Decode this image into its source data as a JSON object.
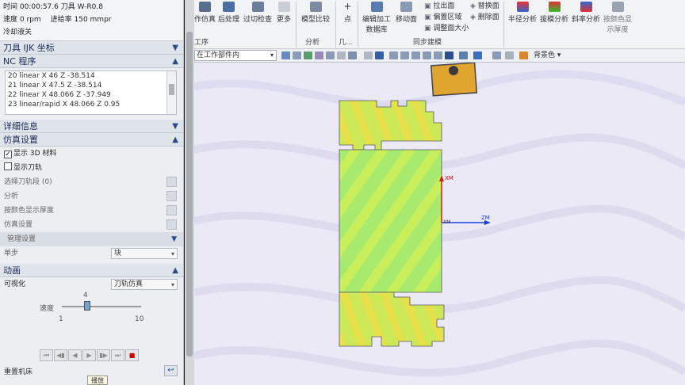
{
  "status": {
    "line1": "时间 00:00:57.6 刀具 W-R0.8",
    "speed": "速度 0 rpm",
    "feed": "进给率 150 mmpr",
    "coolant": "冷却液关"
  },
  "sections": {
    "tool_ijk": "刀具 IJK 坐标",
    "nc_program": "NC 程序",
    "details": "详细信息",
    "sim_settings": "仿真设置",
    "animation": "动画"
  },
  "nc_lines": [
    "20 linear X 46 Z -38.514",
    "21 linear X 47.5 Z -38.514",
    "22 linear X 48.066 Z -37.949",
    "23 linear/rapid X 48.066 Z 0.95"
  ],
  "sim": {
    "show_3d": "显示 3D 材料",
    "show_3d_checked": true,
    "show_toolpath": "显示刀轨",
    "show_toolpath_checked": false,
    "select_segment": "选择刀轨段 (0)",
    "analysis": "分析",
    "color_by_thickness": "按颜色显示厚度",
    "sim_settings_item": "仿真设置",
    "manage_settings": "管理设置",
    "step_label": "单步",
    "step_value": "块"
  },
  "animation": {
    "visualize_label": "可视化",
    "visualize_value": "刀轨仿真",
    "speed_label": "速度",
    "speed_value": "4",
    "speed_min": "1",
    "speed_max": "10",
    "reset": "重置机床",
    "tooltip": "播放"
  },
  "ribbon": {
    "btn_sim": "作仿真",
    "btn_post": "后处理",
    "btn_check": "过切检查",
    "btn_more": "更多",
    "btn_compare": "模型比较",
    "btn_point": "点",
    "btn_edit_blank": "编辑加工",
    "btn_edit_blank2": "数据库",
    "btn_move_face": "移动面",
    "btn_pull_face": "拉出面",
    "btn_offset_area": "偏置区域",
    "btn_adjust_face": "调整面大小",
    "btn_replace_face": "替换面",
    "btn_delete_face": "删除面",
    "btn_radius": "半径分析",
    "btn_draft": "拔模分析",
    "btn_slope": "斜率分析",
    "btn_color": "按颜色显",
    "btn_color2": "示厚度",
    "grp_procedure": "工序",
    "grp_analysis": "分析",
    "grp_point": "几...",
    "grp_sync": "同步建模"
  },
  "toolbar": {
    "selection_scope": "在工作部件内",
    "background": "背景色"
  },
  "axes": {
    "xm": "XM",
    "zm": "ZM"
  },
  "colors": {
    "panel": "#eceef2",
    "viewport": "#ece9f7",
    "part_green": "#9fe66a",
    "part_yellow": "#e8e244",
    "axis_blue": "#1a3fd8",
    "axis_red": "#d42020"
  }
}
